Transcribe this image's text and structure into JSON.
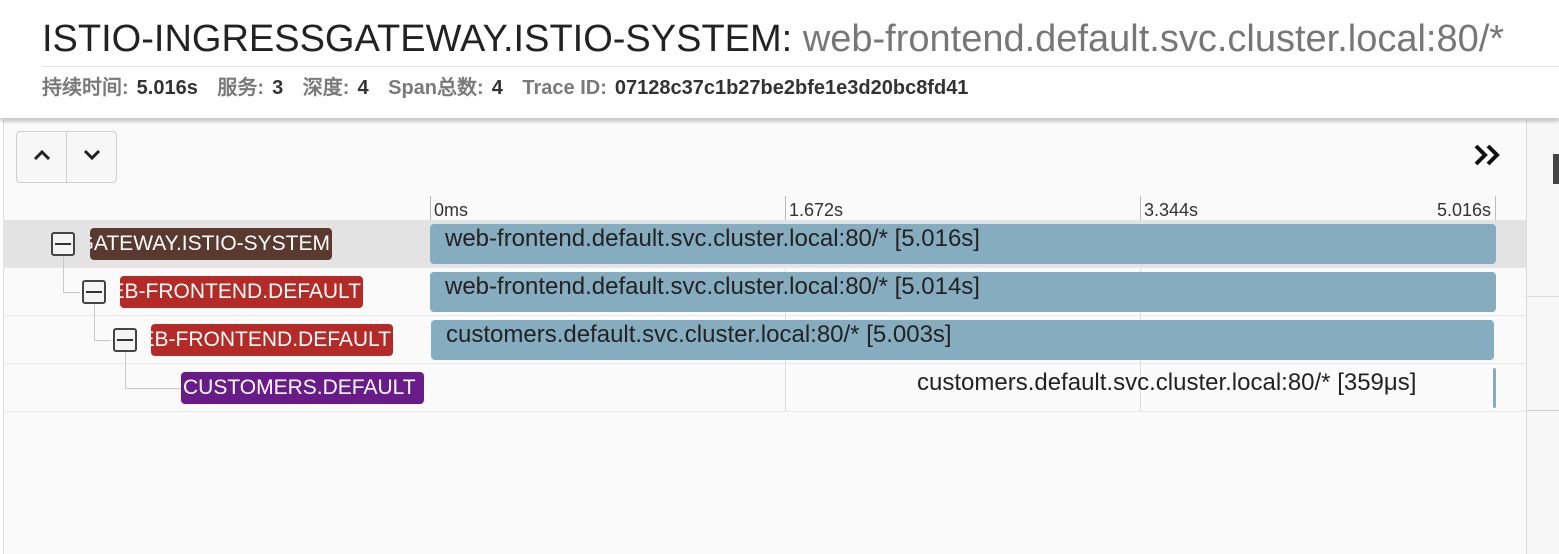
{
  "header": {
    "service": "ISTIO-INGRESSGATEWAY.ISTIO-SYSTEM:",
    "operation": "web-frontend.default.svc.cluster.local:80/*",
    "meta": [
      {
        "key": "持续时间:",
        "value": "5.016s"
      },
      {
        "key": "服务:",
        "value": "3"
      },
      {
        "key": "深度:",
        "value": "4"
      },
      {
        "key": "Span总数:",
        "value": "4"
      },
      {
        "key": "Trace ID:",
        "value": "07128c37c1b27be2bfe1e3d20bc8fd41"
      }
    ]
  },
  "toolbar": {
    "up_icon": "chevron-up-icon",
    "down_icon": "chevron-down-icon",
    "expand_icon": "double-chevron-right-icon"
  },
  "timeline": {
    "ticks": [
      "0ms",
      "1.672s",
      "3.344s",
      "5.016s"
    ]
  },
  "spans": [
    {
      "service": "ISTIO-INGRESSGATEWAY.ISTIO-SYSTEM",
      "color": "#5a3a2e",
      "bar_label": "web-frontend.default.svc.cluster.local:80/* [5.016s]",
      "start_s": 0.0,
      "duration_s": 5.016,
      "depth": 0,
      "selected": true,
      "collapsible": true
    },
    {
      "service": "WEB-FRONTEND.DEFAULT",
      "color": "#b32a26",
      "bar_label": "web-frontend.default.svc.cluster.local:80/* [5.014s]",
      "start_s": 0.0,
      "duration_s": 5.014,
      "depth": 1,
      "selected": false,
      "collapsible": true
    },
    {
      "service": "WEB-FRONTEND.DEFAULT",
      "color": "#b32a26",
      "bar_label": "customers.default.svc.cluster.local:80/* [5.003s]",
      "start_s": 0.005,
      "duration_s": 5.003,
      "depth": 2,
      "selected": false,
      "collapsible": true
    },
    {
      "service": "CUSTOMERS.DEFAULT",
      "color": "#6a1b8a",
      "bar_label": "customers.default.svc.cluster.local:80/* [359μs]",
      "start_s": 5.007,
      "duration_s": 0.000359,
      "depth": 3,
      "selected": false,
      "collapsible": false
    }
  ]
}
